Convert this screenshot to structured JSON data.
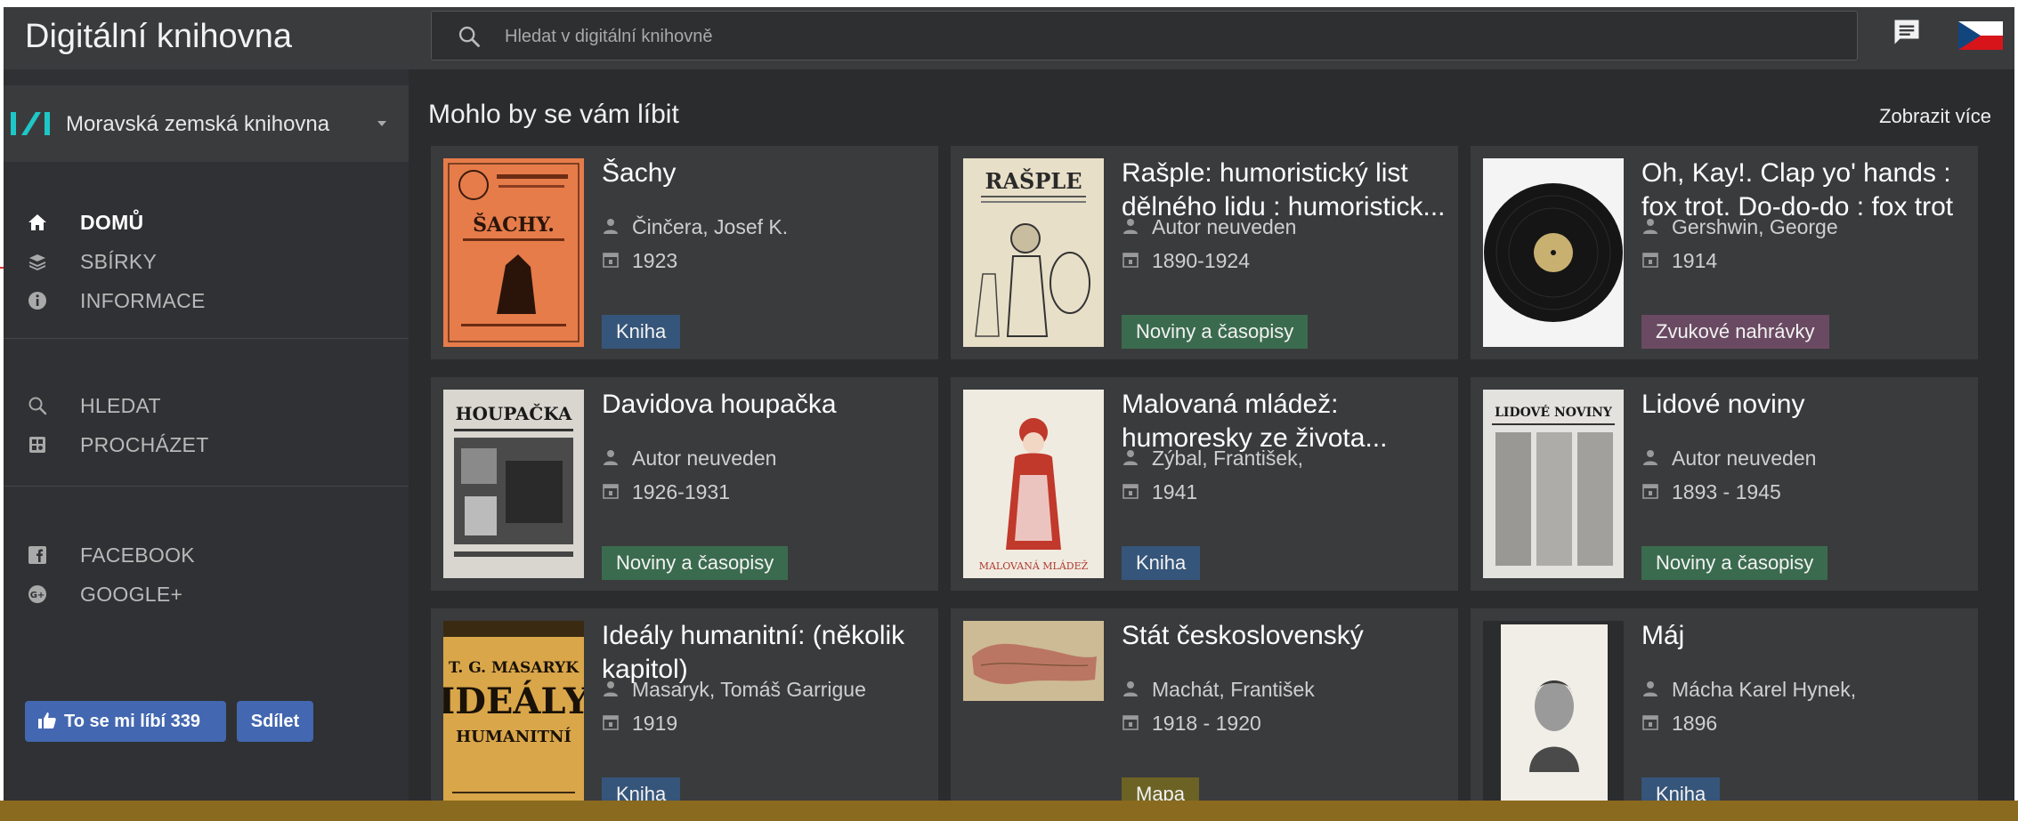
{
  "app": {
    "title": "Digitální knihovna"
  },
  "search": {
    "placeholder": "Hledat v digitální knihovně"
  },
  "header_icons": {
    "chat": "chat-icon",
    "flag": "czech-flag-icon"
  },
  "sidebar": {
    "library": {
      "name": "Moravská zemská knihovna",
      "accent": "#1ec7c7"
    },
    "items": [
      {
        "id": "home",
        "label": "DOMŮ",
        "icon": "home-icon",
        "active": true
      },
      {
        "id": "collections",
        "label": "SBÍRKY",
        "icon": "collections-icon",
        "active": false
      },
      {
        "id": "info",
        "label": "INFORMACE",
        "icon": "info-icon",
        "active": false
      },
      {
        "id": "search",
        "label": "HLEDAT",
        "icon": "search-icon",
        "active": false
      },
      {
        "id": "browse",
        "label": "PROCHÁZET",
        "icon": "browse-icon",
        "active": false
      },
      {
        "id": "facebook",
        "label": "FACEBOOK",
        "icon": "facebook-icon",
        "active": false
      },
      {
        "id": "googleplus",
        "label": "GOOGLE+",
        "icon": "google-plus-icon",
        "active": false
      }
    ],
    "facebook": {
      "like_label": "To se mi líbí 339",
      "share_label": "Sdílet",
      "color": "#4367b0"
    }
  },
  "main": {
    "section_title": "Mohlo by se vám líbit",
    "more_label": "Zobrazit více",
    "cards": [
      {
        "title": "Šachy",
        "author": "Činčera, Josef K.",
        "year": "1923",
        "type": "Kniha"
      },
      {
        "title": "Rašple: humoristický list dělného lidu : humoristick...",
        "author": "Autor neuveden",
        "year": "1890-1924",
        "type": "Noviny a časopisy"
      },
      {
        "title": "Oh, Kay!. Clap yo' hands : fox trot. Do-do-do : fox trot",
        "author": "Gershwin, George",
        "year": "1914",
        "type": "Zvukové nahrávky"
      },
      {
        "title": "Davidova houpačka",
        "author": "Autor neuveden",
        "year": "1926-1931",
        "type": "Noviny a časopisy"
      },
      {
        "title": "Malovaná mládež: humoresky ze života...",
        "author": "Zýbal, František,",
        "year": "1941",
        "type": "Kniha"
      },
      {
        "title": "Lidové noviny",
        "author": "Autor neuveden",
        "year": "1893 - 1945",
        "type": "Noviny a časopisy"
      },
      {
        "title": "Ideály humanitní: (několik kapitol)",
        "author": "Masaryk, Tomáš Garrigue",
        "year": "1919",
        "type": "Kniha"
      },
      {
        "title": "Stát československý",
        "author": "Machát, František",
        "year": "1918 - 1920",
        "type": "Mapa"
      },
      {
        "title": "Máj",
        "author": "Mácha Karel Hynek,",
        "year": "1896",
        "type": "Kniha"
      }
    ]
  },
  "thumb_texts": {
    "sachy": "ŠACHY.",
    "rasple": "RAŠPLE",
    "davidova": "HOUPAČKA",
    "malovana": "MALOVANÁ MLÁDEŽ",
    "lidove": "LIDOVÉ NOVINY",
    "idealy": [
      "T. G. MASARYK",
      "IDEÁLY",
      "HUMANITNÍ"
    ]
  },
  "badge_colors": {
    "Kniha": "#36557a",
    "Noviny a časopisy": "#3b6b4e",
    "Zvukové nahrávky": "#6a4a62",
    "Mapa": "#6c6224"
  }
}
